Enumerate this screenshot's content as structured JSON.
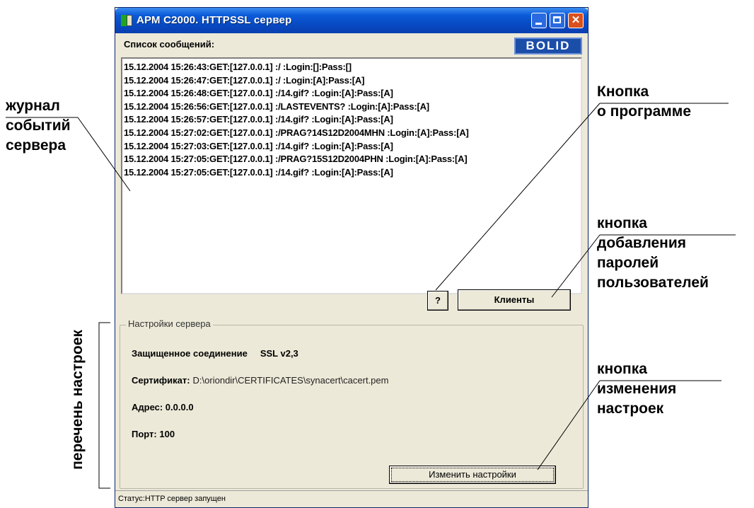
{
  "window": {
    "title": "АРМ С2000. HTTPSSL сервер",
    "list_caption": "Список сообщений:",
    "logo_text": "BOLID",
    "log_lines": [
      "15.12.2004 15:26:43:GET:[127.0.0.1] :/ :Login:[]:Pass:[]",
      "15.12.2004 15:26:47:GET:[127.0.0.1] :/ :Login:[A]:Pass:[A]",
      "15.12.2004 15:26:48:GET:[127.0.0.1] :/14.gif? :Login:[A]:Pass:[A]",
      "15.12.2004 15:26:56:GET:[127.0.0.1] :/LASTEVENTS? :Login:[A]:Pass:[A]",
      "15.12.2004 15:26:57:GET:[127.0.0.1] :/14.gif? :Login:[A]:Pass:[A]",
      "15.12.2004 15:27:02:GET:[127.0.0.1] :/PRAG?14S12D2004MHN :Login:[A]:Pass:[A]",
      "15.12.2004 15:27:03:GET:[127.0.0.1] :/14.gif? :Login:[A]:Pass:[A]",
      "15.12.2004 15:27:05:GET:[127.0.0.1] :/PRAG?15S12D2004PHN :Login:[A]:Pass:[A]",
      "15.12.2004 15:27:05:GET:[127.0.0.1] :/14.gif? :Login:[A]:Pass:[A]"
    ],
    "about_button": "?",
    "clients_button": "Клиенты",
    "settings": {
      "legend": "Настройки сервера",
      "connection_label": "Защищенное соединение",
      "connection_value": "SSL v2,3",
      "certificate_label": "Сертификат:",
      "certificate_value": "D:\\oriondir\\CERTIFICATES\\synacert\\cacert.pem",
      "address": "Адрес: 0.0.0.0",
      "port": "Порт: 100",
      "change_button": "Изменить настройки"
    },
    "status": "Статус:HTTP сервер запущен"
  },
  "annotations": {
    "event_log": [
      "журнал",
      "событий",
      "сервера"
    ],
    "about_button": [
      "Кнопка",
      "о программе"
    ],
    "clients_button": [
      "кнопка",
      "добавления",
      "паролей",
      "пользователей"
    ],
    "change_settings_button": [
      "кнопка",
      "изменения",
      "настроек"
    ],
    "settings_list": "перечень настроек"
  },
  "colors": {
    "title_bar": "#0a5ad8",
    "window_bg": "#ece9d8",
    "close_button": "#d9501e",
    "logo_bg": "#1b4ea8"
  }
}
